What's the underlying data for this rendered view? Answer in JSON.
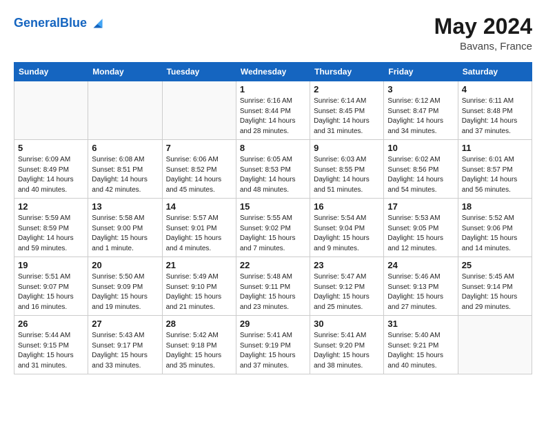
{
  "header": {
    "logo_general": "General",
    "logo_blue": "Blue",
    "month_year": "May 2024",
    "location": "Bavans, France"
  },
  "days_of_week": [
    "Sunday",
    "Monday",
    "Tuesday",
    "Wednesday",
    "Thursday",
    "Friday",
    "Saturday"
  ],
  "weeks": [
    [
      {
        "num": "",
        "info": ""
      },
      {
        "num": "",
        "info": ""
      },
      {
        "num": "",
        "info": ""
      },
      {
        "num": "1",
        "info": "Sunrise: 6:16 AM\nSunset: 8:44 PM\nDaylight: 14 hours\nand 28 minutes."
      },
      {
        "num": "2",
        "info": "Sunrise: 6:14 AM\nSunset: 8:45 PM\nDaylight: 14 hours\nand 31 minutes."
      },
      {
        "num": "3",
        "info": "Sunrise: 6:12 AM\nSunset: 8:47 PM\nDaylight: 14 hours\nand 34 minutes."
      },
      {
        "num": "4",
        "info": "Sunrise: 6:11 AM\nSunset: 8:48 PM\nDaylight: 14 hours\nand 37 minutes."
      }
    ],
    [
      {
        "num": "5",
        "info": "Sunrise: 6:09 AM\nSunset: 8:49 PM\nDaylight: 14 hours\nand 40 minutes."
      },
      {
        "num": "6",
        "info": "Sunrise: 6:08 AM\nSunset: 8:51 PM\nDaylight: 14 hours\nand 42 minutes."
      },
      {
        "num": "7",
        "info": "Sunrise: 6:06 AM\nSunset: 8:52 PM\nDaylight: 14 hours\nand 45 minutes."
      },
      {
        "num": "8",
        "info": "Sunrise: 6:05 AM\nSunset: 8:53 PM\nDaylight: 14 hours\nand 48 minutes."
      },
      {
        "num": "9",
        "info": "Sunrise: 6:03 AM\nSunset: 8:55 PM\nDaylight: 14 hours\nand 51 minutes."
      },
      {
        "num": "10",
        "info": "Sunrise: 6:02 AM\nSunset: 8:56 PM\nDaylight: 14 hours\nand 54 minutes."
      },
      {
        "num": "11",
        "info": "Sunrise: 6:01 AM\nSunset: 8:57 PM\nDaylight: 14 hours\nand 56 minutes."
      }
    ],
    [
      {
        "num": "12",
        "info": "Sunrise: 5:59 AM\nSunset: 8:59 PM\nDaylight: 14 hours\nand 59 minutes."
      },
      {
        "num": "13",
        "info": "Sunrise: 5:58 AM\nSunset: 9:00 PM\nDaylight: 15 hours\nand 1 minute."
      },
      {
        "num": "14",
        "info": "Sunrise: 5:57 AM\nSunset: 9:01 PM\nDaylight: 15 hours\nand 4 minutes."
      },
      {
        "num": "15",
        "info": "Sunrise: 5:55 AM\nSunset: 9:02 PM\nDaylight: 15 hours\nand 7 minutes."
      },
      {
        "num": "16",
        "info": "Sunrise: 5:54 AM\nSunset: 9:04 PM\nDaylight: 15 hours\nand 9 minutes."
      },
      {
        "num": "17",
        "info": "Sunrise: 5:53 AM\nSunset: 9:05 PM\nDaylight: 15 hours\nand 12 minutes."
      },
      {
        "num": "18",
        "info": "Sunrise: 5:52 AM\nSunset: 9:06 PM\nDaylight: 15 hours\nand 14 minutes."
      }
    ],
    [
      {
        "num": "19",
        "info": "Sunrise: 5:51 AM\nSunset: 9:07 PM\nDaylight: 15 hours\nand 16 minutes."
      },
      {
        "num": "20",
        "info": "Sunrise: 5:50 AM\nSunset: 9:09 PM\nDaylight: 15 hours\nand 19 minutes."
      },
      {
        "num": "21",
        "info": "Sunrise: 5:49 AM\nSunset: 9:10 PM\nDaylight: 15 hours\nand 21 minutes."
      },
      {
        "num": "22",
        "info": "Sunrise: 5:48 AM\nSunset: 9:11 PM\nDaylight: 15 hours\nand 23 minutes."
      },
      {
        "num": "23",
        "info": "Sunrise: 5:47 AM\nSunset: 9:12 PM\nDaylight: 15 hours\nand 25 minutes."
      },
      {
        "num": "24",
        "info": "Sunrise: 5:46 AM\nSunset: 9:13 PM\nDaylight: 15 hours\nand 27 minutes."
      },
      {
        "num": "25",
        "info": "Sunrise: 5:45 AM\nSunset: 9:14 PM\nDaylight: 15 hours\nand 29 minutes."
      }
    ],
    [
      {
        "num": "26",
        "info": "Sunrise: 5:44 AM\nSunset: 9:15 PM\nDaylight: 15 hours\nand 31 minutes."
      },
      {
        "num": "27",
        "info": "Sunrise: 5:43 AM\nSunset: 9:17 PM\nDaylight: 15 hours\nand 33 minutes."
      },
      {
        "num": "28",
        "info": "Sunrise: 5:42 AM\nSunset: 9:18 PM\nDaylight: 15 hours\nand 35 minutes."
      },
      {
        "num": "29",
        "info": "Sunrise: 5:41 AM\nSunset: 9:19 PM\nDaylight: 15 hours\nand 37 minutes."
      },
      {
        "num": "30",
        "info": "Sunrise: 5:41 AM\nSunset: 9:20 PM\nDaylight: 15 hours\nand 38 minutes."
      },
      {
        "num": "31",
        "info": "Sunrise: 5:40 AM\nSunset: 9:21 PM\nDaylight: 15 hours\nand 40 minutes."
      },
      {
        "num": "",
        "info": ""
      }
    ]
  ]
}
